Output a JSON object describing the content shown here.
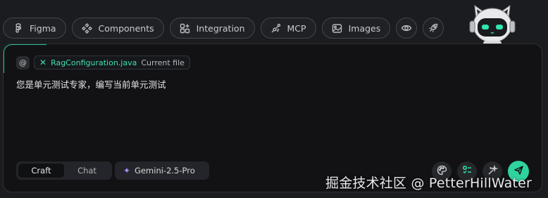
{
  "toolbar": {
    "items": [
      {
        "label": "Figma",
        "icon": "figma-icon"
      },
      {
        "label": "Components",
        "icon": "components-icon"
      },
      {
        "label": "Integration",
        "icon": "integration-icon"
      },
      {
        "label": "MCP",
        "icon": "mcp-icon"
      },
      {
        "label": "Images",
        "icon": "image-icon"
      }
    ],
    "extra_icons": [
      "eye-icon",
      "rocket-icon"
    ]
  },
  "context": {
    "at_symbol": "@",
    "file_remove": "✕",
    "file_name": "RagConfiguration.java",
    "file_tag": "Current file"
  },
  "prompt": {
    "text": "您是单元测试专家，编写当前单元测试"
  },
  "mode": {
    "options": [
      "Craft",
      "Chat"
    ],
    "active": "Craft"
  },
  "model": {
    "icon": "✦",
    "name": "Gemini-2.5-Pro"
  },
  "actions": [
    "palette-icon",
    "checklist-icon",
    "sparkle-wand-icon",
    "send-icon"
  ],
  "colors": {
    "accent": "#2ee6ae",
    "send_button": "#2fd39f",
    "model_star": "#a98cf3",
    "background": "#1b1c1f",
    "panel": "#121214"
  },
  "watermark": "掘金技术社区 @ PetterHillWater"
}
